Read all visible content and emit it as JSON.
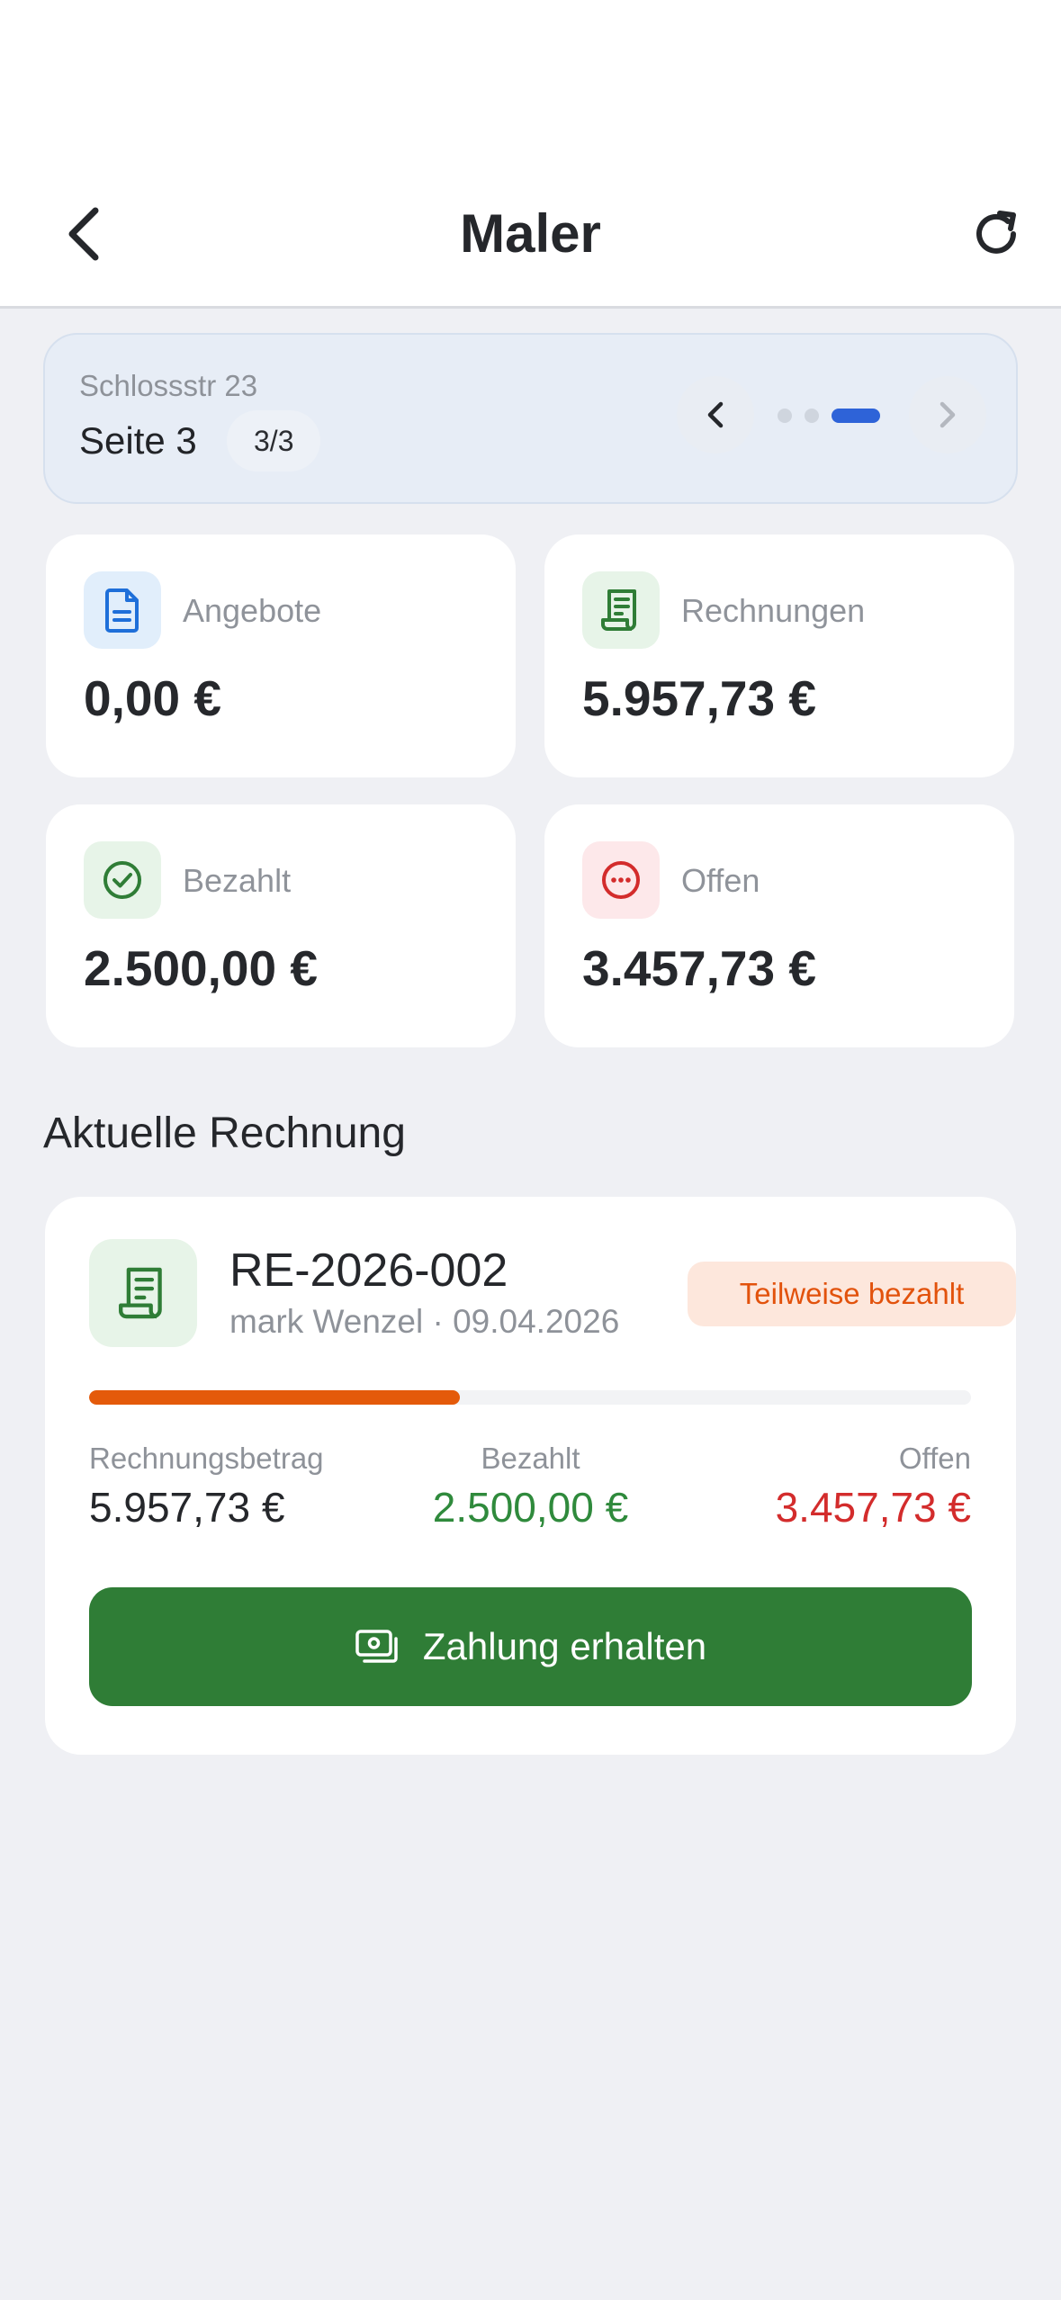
{
  "header": {
    "title": "Maler",
    "back_icon": "chevron-left-icon",
    "refresh_icon": "refresh-icon"
  },
  "pager": {
    "address": "Schlossstr 23",
    "page_label": "Seite 3",
    "page_count": "3/3",
    "current_index": 3,
    "total": 3,
    "accent_color": "#2e63d8"
  },
  "stats": {
    "angebote": {
      "label": "Angebote",
      "value": "0,00 €",
      "icon": "document-icon",
      "color": "#1e6fd9"
    },
    "rechnungen": {
      "label": "Rechnungen",
      "value": "5.957,73 €",
      "icon": "receipt-icon",
      "color": "#2f7d36"
    },
    "bezahlt": {
      "label": "Bezahlt",
      "value": "2.500,00 €",
      "icon": "check-circle-icon",
      "color": "#2f7d36"
    },
    "offen": {
      "label": "Offen",
      "value": "3.457,73 €",
      "icon": "more-circle-icon",
      "color": "#d32c2c"
    }
  },
  "section": {
    "title": "Aktuelle Rechnung"
  },
  "invoice": {
    "number": "RE-2026-002",
    "meta": "mark Wenzel · 09.04.2026",
    "status": "Teilweise bezahlt",
    "paid_fraction": 0.42,
    "amounts": {
      "total_label": "Rechnungsbetrag",
      "total_value": "5.957,73 €",
      "paid_label": "Bezahlt",
      "paid_value": "2.500,00 €",
      "open_label": "Offen",
      "open_value": "3.457,73 €"
    },
    "action_label": "Zahlung erhalten",
    "action_icon": "cash-icon"
  }
}
